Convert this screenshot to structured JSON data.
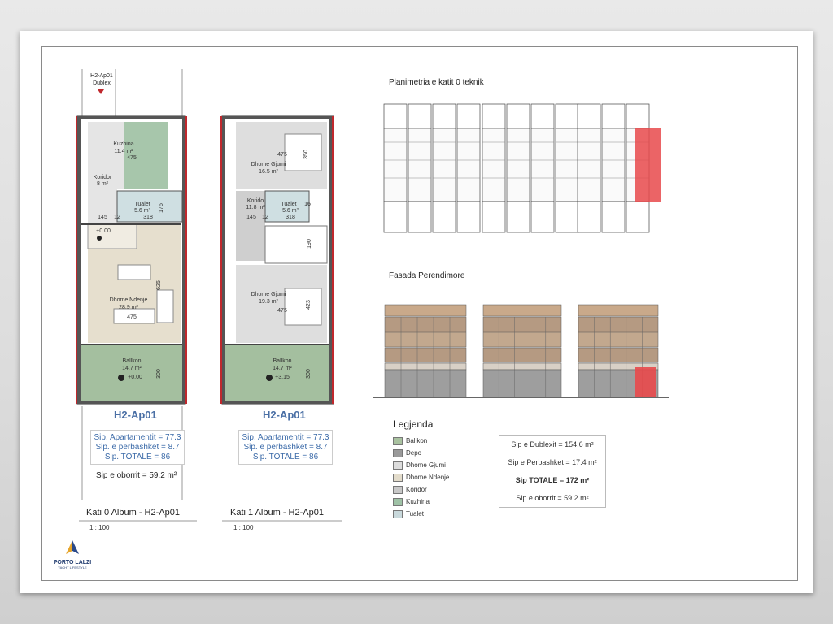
{
  "marker": {
    "line1": "H2-Ap01",
    "line2": "Dublex"
  },
  "floor0": {
    "rooms": {
      "kuzhina": {
        "name": "Kuzhina",
        "area": "11.4 m²",
        "dim": "475"
      },
      "koridor": {
        "name": "Koridor",
        "area": "8 m²"
      },
      "tualet": {
        "name": "Tualet",
        "area": "5.6 m²",
        "dim": "318"
      },
      "ndenje": {
        "name": "Dhome Ndenje",
        "area": "28.9 m²",
        "dim": "475",
        "dim2": "625"
      },
      "ballkon": {
        "name": "Ballkon",
        "area": "14.7 m²",
        "level": "+0.00",
        "dim": "300"
      }
    },
    "dims": {
      "d145": "145",
      "d12": "12",
      "d176": "176"
    },
    "level": "+0.00",
    "apt_label": "H2-Ap01",
    "stats": [
      "Sip. Apartamentit = 77.3",
      "Sip. e perbashket = 8.7",
      "Sip. TOTALE = 86"
    ],
    "yard": "Sip e oborrit = 59.2 m²",
    "caption": "Kati 0 Album - H2-Ap01",
    "scale": "1 : 100"
  },
  "floor1": {
    "rooms": {
      "gjumi1": {
        "name": "Dhome Gjumi",
        "area": "16.5 m²",
        "dim": "475",
        "dim2": "350"
      },
      "koridor": {
        "name": "Korido",
        "area": "11.8 m²"
      },
      "tualet": {
        "name": "Tualet",
        "area": "5.6 m²",
        "dim": "318",
        "dim2": "16"
      },
      "gjumi2": {
        "name": "Dhome Gjumi",
        "area": "19.3 m²",
        "dim": "475",
        "dim2": "423"
      },
      "ballkon": {
        "name": "Ballkon",
        "area": "14.7 m²",
        "level": "+3.15",
        "dim": "300"
      }
    },
    "dims": {
      "d145": "145",
      "d12": "12",
      "d190": "190"
    },
    "apt_label": "H2-Ap01",
    "stats": [
      "Sip. Apartamentit = 77.3",
      "Sip. e perbashket = 8.7",
      "Sip. TOTALE = 86"
    ],
    "caption": "Kati 1 Album - H2-Ap01",
    "scale": "1 : 100"
  },
  "site_plan_title": "Planimetria e katit 0 teknik",
  "facade_title": "Fasada Perendimore",
  "legend": {
    "title": "Legjenda",
    "items": [
      {
        "label": "Ballkon",
        "color": "#a9c2a0"
      },
      {
        "label": "Depo",
        "color": "#9a9a9a"
      },
      {
        "label": "Dhome Gjumi",
        "color": "#dcdcdc"
      },
      {
        "label": "Dhome Ndenje",
        "color": "#e3dccb"
      },
      {
        "label": "Koridor",
        "color": "#c8c8c8"
      },
      {
        "label": "Kuzhina",
        "color": "#9fc2a6"
      },
      {
        "label": "Tualet",
        "color": "#c9d9dc"
      }
    ]
  },
  "summary": {
    "dublex": "Sip e Dublexit = 154.6 m²",
    "perbashket": "Sip e Perbashket = 17.4 m²",
    "totale": "Sip TOTALE = 172 m²",
    "oborrit": "Sip e oborrit = 59.2 m²"
  },
  "logo": {
    "name": "PORTO LALZI",
    "tagline": "YACHT LIFESTYLE"
  },
  "colors": {
    "highlight_red": "#e8494b",
    "label_blue": "#4a6fa5",
    "wall_red": "#c0282d"
  }
}
